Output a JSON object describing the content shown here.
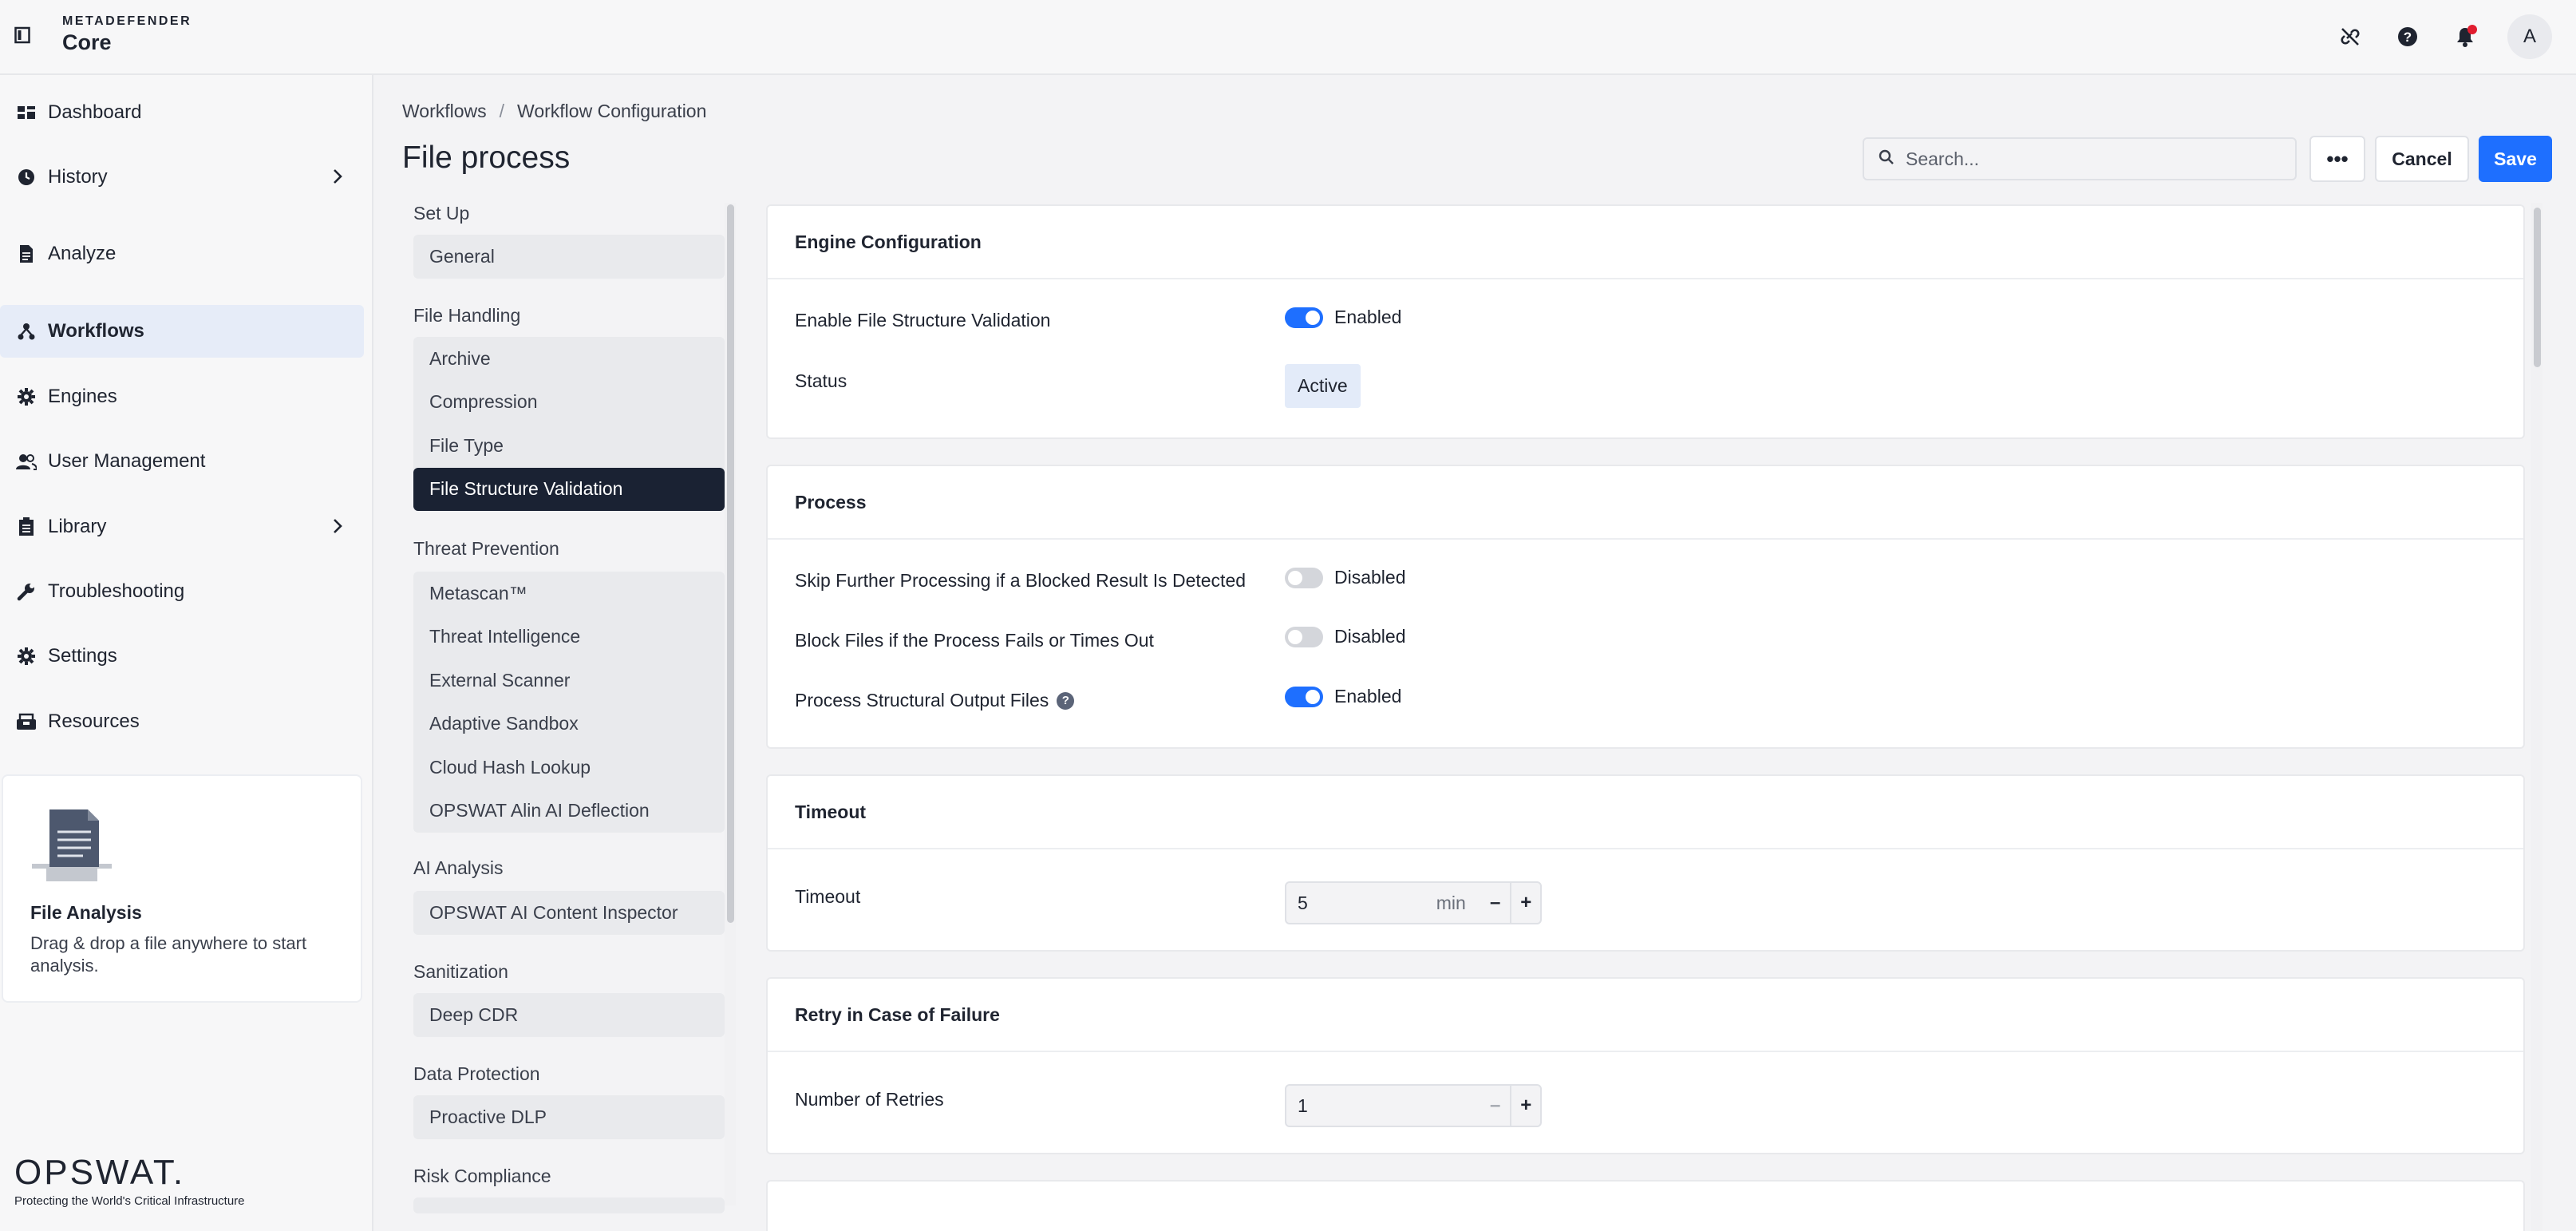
{
  "brand": {
    "line1": "METADEFENDER",
    "line2": "Core"
  },
  "topbar": {
    "avatar_letter": "A"
  },
  "sidebar": {
    "items": [
      {
        "label": "Dashboard",
        "icon": "dashboard-icon"
      },
      {
        "label": "History",
        "icon": "history-icon"
      },
      {
        "label": "Analyze",
        "icon": "analyze-icon"
      },
      {
        "label": "Workflows",
        "icon": "workflows-icon",
        "active": true
      },
      {
        "label": "Engines",
        "icon": "gear-icon"
      },
      {
        "label": "User Management",
        "icon": "users-icon"
      },
      {
        "label": "Library",
        "icon": "library-icon"
      },
      {
        "label": "Troubleshooting",
        "icon": "wrench-icon"
      },
      {
        "label": "Settings",
        "icon": "gear-icon"
      },
      {
        "label": "Resources",
        "icon": "resources-icon"
      }
    ],
    "file_analysis": {
      "title": "File Analysis",
      "subtitle": "Drag & drop a file anywhere to start analysis."
    },
    "footer": {
      "logo": "OPSWAT.",
      "tagline": "Protecting the World's Critical Infrastructure"
    }
  },
  "breadcrumb": {
    "items": [
      "Workflows",
      "Workflow Configuration"
    ],
    "separator": "/"
  },
  "page_title": "File process",
  "toolbar": {
    "search_placeholder": "Search...",
    "more_label": "•••",
    "cancel_label": "Cancel",
    "save_label": "Save"
  },
  "subnav": {
    "groups": [
      {
        "label": "Set Up",
        "items": [
          "General"
        ]
      },
      {
        "label": "File Handling",
        "items": [
          "Archive",
          "Compression",
          "File Type",
          "File Structure Validation"
        ]
      },
      {
        "label": "Threat Prevention",
        "items": [
          "Metascan™",
          "Threat Intelligence",
          "External Scanner",
          "Adaptive Sandbox",
          "Cloud Hash Lookup",
          "OPSWAT Alin AI Deflection"
        ]
      },
      {
        "label": "AI Analysis",
        "items": [
          "OPSWAT AI Content Inspector"
        ]
      },
      {
        "label": "Sanitization",
        "items": [
          "Deep CDR"
        ]
      },
      {
        "label": "Data Protection",
        "items": [
          "Proactive DLP"
        ]
      },
      {
        "label": "Risk Compliance",
        "items": []
      }
    ],
    "active_item": "File Structure Validation"
  },
  "cards": {
    "engine": {
      "title": "Engine Configuration",
      "rows": [
        {
          "label": "Enable File Structure Validation",
          "value": "Enabled",
          "on": true
        },
        {
          "label": "Status",
          "value": "Active"
        }
      ]
    },
    "process": {
      "title": "Process",
      "rows": [
        {
          "label": "Skip Further Processing if a Blocked Result Is Detected",
          "value": "Disabled",
          "on": false
        },
        {
          "label": "Block Files if the Process Fails or Times Out",
          "value": "Disabled",
          "on": false
        },
        {
          "label": "Process Structural Output Files",
          "value": "Enabled",
          "on": true,
          "help": "?"
        }
      ]
    },
    "timeout": {
      "title": "Timeout",
      "rows": [
        {
          "label": "Timeout",
          "value": "5",
          "unit": "min"
        }
      ]
    },
    "retry": {
      "title": "Retry in Case of Failure",
      "rows": [
        {
          "label": "Number of Retries",
          "value": "1"
        }
      ]
    }
  },
  "colors": {
    "primary": "#1e6fff",
    "nav_active_bg": "#1a2233",
    "sidebar_active_bg": "#e6ecf8",
    "notification": "#e11d2f"
  }
}
